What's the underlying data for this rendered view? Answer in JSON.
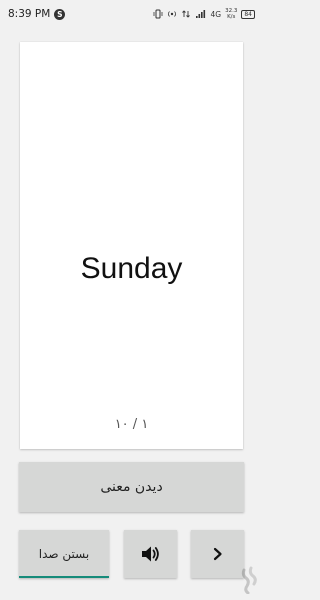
{
  "status_bar": {
    "time": "8:39 PM",
    "notification_badge": "S",
    "network_speed_value": "32.3",
    "network_speed_unit": "K/s",
    "battery": "84",
    "signal_label": "4G"
  },
  "card": {
    "word": "Sunday",
    "counter": "۱ / ۱۰"
  },
  "buttons": {
    "show_meaning": "دیدن معنی",
    "mute": "بستن صدا",
    "next_symbol": "›"
  },
  "icons": {
    "speaker": "speaker-icon",
    "next": "chevron-right-icon"
  },
  "colors": {
    "accent_underline": "#168b7a",
    "button_bg": "#d6d7d6",
    "background": "#f1f1f1"
  }
}
